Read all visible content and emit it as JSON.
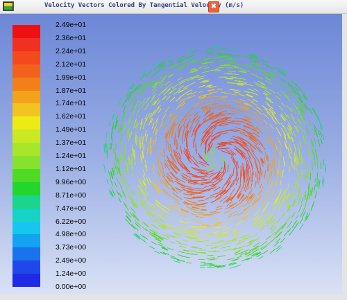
{
  "window": {
    "title": "Velocity Vectors Colored By Tangential Velocity (m/s)",
    "close_symbol": "✖",
    "app_icon": "fluent-app-icon"
  },
  "colorbar": {
    "labels": [
      "2.49e+01",
      "2.36e+01",
      "2.24e+01",
      "2.12e+01",
      "1.99e+01",
      "1.87e+01",
      "1.74e+01",
      "1.62e+01",
      "1.49e+01",
      "1.37e+01",
      "1.24e+01",
      "1.12e+01",
      "9.96e+00",
      "8.71e+00",
      "7.47e+00",
      "6.22e+00",
      "4.98e+00",
      "3.73e+00",
      "2.49e+00",
      "1.24e+00",
      "0.00e+00"
    ],
    "colors": [
      "#ee1111",
      "#f03020",
      "#f24a1e",
      "#f2621c",
      "#f27f18",
      "#f3a21a",
      "#f3c41f",
      "#ecec14",
      "#c9ea22",
      "#a8e62a",
      "#86e22c",
      "#4fdb24",
      "#22d62c",
      "#1bd58c",
      "#17d3c6",
      "#15c6ee",
      "#13a3f0",
      "#1a73ee",
      "#1f48ea",
      "#1f2ae6"
    ]
  }
}
